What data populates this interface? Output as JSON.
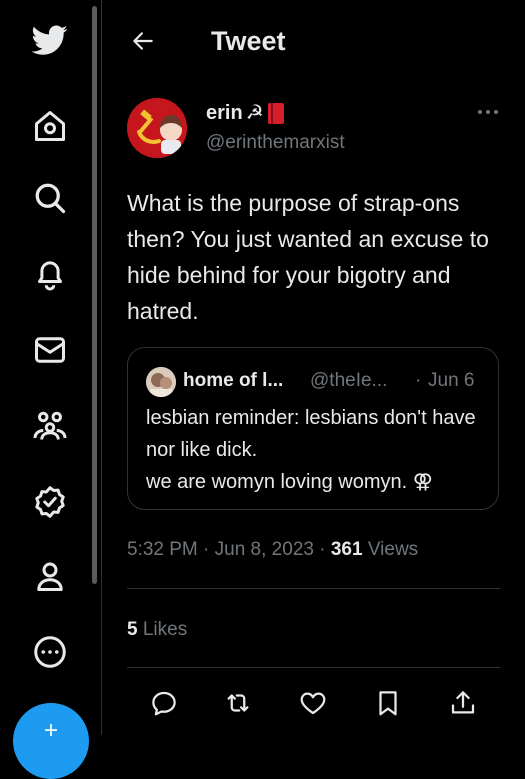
{
  "header": {
    "title": "Tweet"
  },
  "tweet": {
    "display_name": "erin",
    "name_emoji": "☭",
    "handle": "@erinthemarxist",
    "text": "What is the purpose of strap-ons then? You just wanted an excuse to hide behind for your bigotry and hatred.",
    "time": "5:32 PM · Jun 8, 2023 · ",
    "views_count": "361",
    "views_label": " Views",
    "likes_count": "5",
    "likes_label": " Likes"
  },
  "quote": {
    "display_name": "home of l...",
    "handle": "@theIe...",
    "separator": "·",
    "date": "Jun 6",
    "text": "lesbian reminder: lesbians don't have nor like dick.\nwe are womyn loving womyn. ⚢"
  },
  "compose": {
    "label": "+"
  },
  "colors": {
    "background": "#000000",
    "text": "#e7e9ea",
    "muted": "#71767b",
    "border": "#2f3336",
    "accent": "#1d9bf0"
  },
  "icons": {
    "sidebar": [
      "twitter-logo-icon",
      "home-icon",
      "search-icon",
      "bell-icon",
      "mail-icon",
      "communities-icon",
      "verified-icon",
      "profile-icon",
      "more-circle-icon"
    ],
    "actions": [
      "reply-icon",
      "retweet-icon",
      "like-icon",
      "bookmark-icon",
      "share-icon"
    ]
  }
}
